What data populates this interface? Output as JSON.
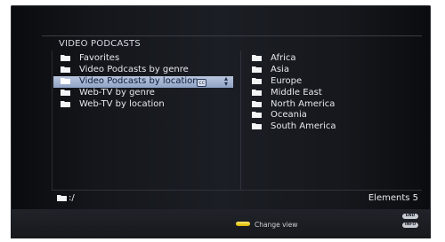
{
  "panel": {
    "title": "VIDEO PODCASTS"
  },
  "left_list": [
    {
      "label": "Favorites"
    },
    {
      "label": "Video Podcasts by genre"
    },
    {
      "label": "Video Podcasts by location",
      "selected": true
    },
    {
      "label": "Web-TV by genre"
    },
    {
      "label": "Web-TV by location"
    }
  ],
  "selected_badge": "cc",
  "right_list": [
    {
      "label": "Africa"
    },
    {
      "label": "Asia"
    },
    {
      "label": "Europe"
    },
    {
      "label": "Middle East"
    },
    {
      "label": "North America"
    },
    {
      "label": "Oceania"
    },
    {
      "label": "South America"
    }
  ],
  "footer": {
    "path": ":/",
    "elements": "Elements 5"
  },
  "bottom_bar": {
    "change_view": "Change view",
    "btn_top": "END",
    "btn_bottom": "INFO"
  },
  "colors": {
    "selection": "#a9b8d4",
    "accent_yellow": "#f2d22a"
  },
  "icons": {
    "folder": "folder-icon",
    "selector": "up-down-arrows-icon",
    "yellow_button": "yellow-button-icon"
  }
}
